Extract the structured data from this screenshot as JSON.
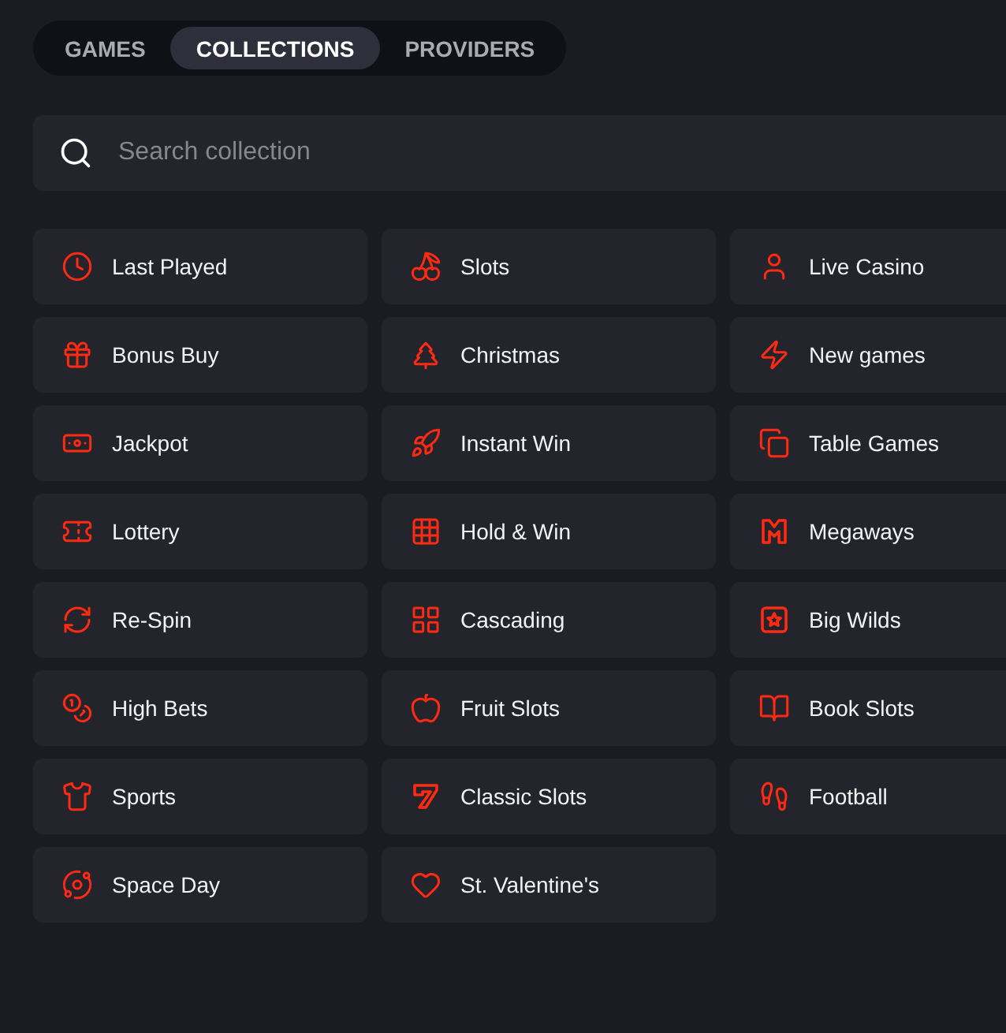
{
  "tabs": [
    {
      "label": "GAMES",
      "selected": false
    },
    {
      "label": "COLLECTIONS",
      "selected": true
    },
    {
      "label": "PROVIDERS",
      "selected": false
    }
  ],
  "search": {
    "placeholder": "Search collection"
  },
  "collections": [
    {
      "label": "Last Played"
    },
    {
      "label": "Slots"
    },
    {
      "label": "Live Casino"
    },
    {
      "label": "Bonus Buy"
    },
    {
      "label": "Christmas"
    },
    {
      "label": "New games"
    },
    {
      "label": "Jackpot"
    },
    {
      "label": "Instant Win"
    },
    {
      "label": "Table Games"
    },
    {
      "label": "Lottery"
    },
    {
      "label": "Hold & Win"
    },
    {
      "label": "Megaways"
    },
    {
      "label": "Re-Spin"
    },
    {
      "label": "Cascading"
    },
    {
      "label": "Big Wilds"
    },
    {
      "label": "High Bets"
    },
    {
      "label": "Fruit Slots"
    },
    {
      "label": "Book Slots"
    },
    {
      "label": "Sports"
    },
    {
      "label": "Classic Slots"
    },
    {
      "label": "Football"
    },
    {
      "label": "Space Day"
    },
    {
      "label": "St. Valentine's"
    }
  ]
}
